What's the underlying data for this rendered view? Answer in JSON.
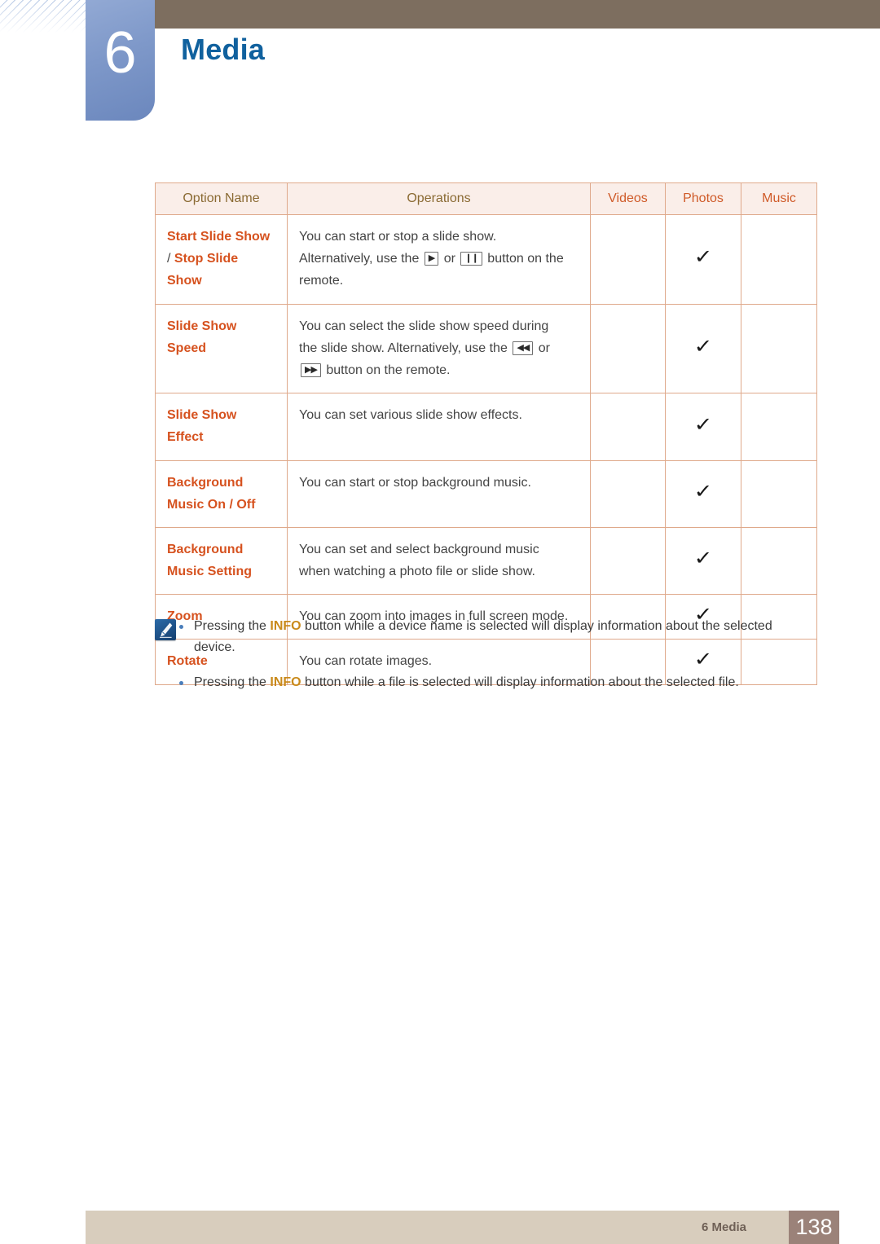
{
  "page": {
    "chapter_number": "6",
    "chapter_title": "Media"
  },
  "table": {
    "headers": {
      "option_name": "Option Name",
      "operations": "Operations",
      "videos": "Videos",
      "photos": "Photos",
      "music": "Music"
    },
    "rows": [
      {
        "option_name_a": "Start Slide Show",
        "option_sep": "/ ",
        "option_name_b": "Stop Slide Show",
        "operation_line1": "You can start or stop a slide show.",
        "operation_line2_pre": "Alternatively, use the",
        "key1": "play-button-icon",
        "operation_line2_mid": "or",
        "key2": "pause-button-icon",
        "operation_line2_post": "button on the remote.",
        "videos": "",
        "photos": "✓",
        "music": ""
      },
      {
        "option_name": "Slide Show Speed",
        "operation_line1": "You can select the slide show speed during",
        "operation_line2_pre": "the slide show. Alternatively, use the",
        "key1": "rewind-button-icon",
        "operation_line2_mid": "or",
        "key2": "fast-forward-button-icon",
        "operation_line2_post": "button on the remote.",
        "videos": "",
        "photos": "✓",
        "music": ""
      },
      {
        "option_name": "Slide Show Effect",
        "operation": "You can set various slide show effects.",
        "videos": "",
        "photos": "✓",
        "music": ""
      },
      {
        "option_name_a": "Background",
        "option_name_b": "Music On / Off",
        "operation": "You can start or stop background music.",
        "videos": "",
        "photos": "✓",
        "music": ""
      },
      {
        "option_name_a": "Background",
        "option_name_b": "Music Setting",
        "operation_line1": "You can set and select background music",
        "operation_line2": "when watching a photo file or slide show.",
        "videos": "",
        "photos": "✓",
        "music": ""
      },
      {
        "option_name": "Zoom",
        "operation": "You can zoom into images in full screen mode.",
        "videos": "",
        "photos": "✓",
        "music": ""
      },
      {
        "option_name": "Rotate",
        "operation": "You can rotate images.",
        "videos": "",
        "photos": "✓",
        "music": ""
      }
    ]
  },
  "notes": {
    "icon": "note-pen-icon",
    "items": [
      {
        "pre": "Pressing the ",
        "keyword": "INFO",
        "post": " button while a device name is selected will display information about the selected device."
      },
      {
        "pre": "Pressing the ",
        "keyword": "INFO",
        "post": " button while a file is selected will display information about the selected file."
      }
    ]
  },
  "footer": {
    "label": "6 Media",
    "page_number": "138"
  },
  "colors": {
    "topbar_brown": "#7d6e5f",
    "chapter_blue": "#10619e",
    "badge_blue": "#7e98c9",
    "option_orange": "#d6521f",
    "header_text": "#8a6a33",
    "media_header_orange": "#cf5a28",
    "table_border": "#dfa98b",
    "table_outer_border": "#a8a86a",
    "header_fill": "#faeee9",
    "info_keyword": "#c98a1b",
    "footer_bar": "#d8cdbd",
    "page_box": "#9b8279"
  }
}
